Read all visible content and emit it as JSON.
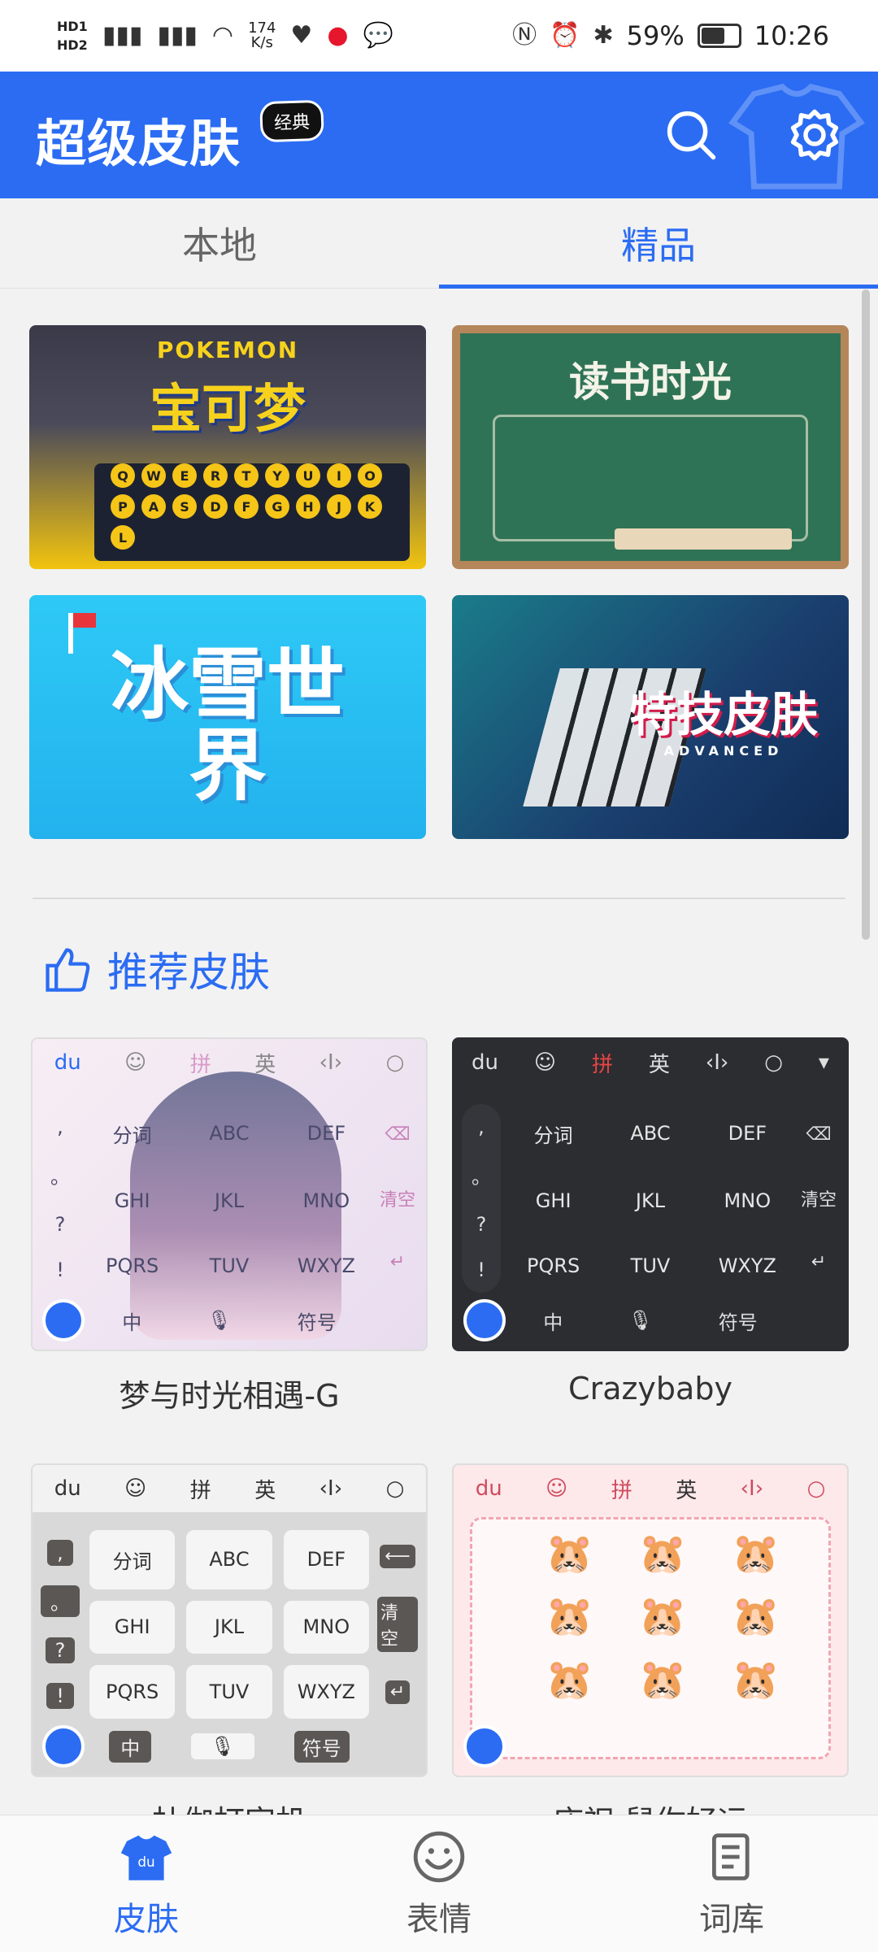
{
  "status_bar": {
    "hd1": "HD1",
    "hd2": "HD2",
    "net_speed": "174\nK/s",
    "battery_percent": "59%",
    "time": "10:26"
  },
  "header": {
    "title": "超级皮肤",
    "badge": "经典",
    "accent_color": "#2b6cf3"
  },
  "tabs": [
    {
      "label": "本地",
      "active": false
    },
    {
      "label": "精品",
      "active": true
    }
  ],
  "banners": [
    {
      "title": "宝可梦",
      "brand": "POKEMON"
    },
    {
      "title": "读书时光"
    },
    {
      "title": "冰雪世界"
    },
    {
      "title": "特技皮肤",
      "subtitle": "ADVANCED"
    }
  ],
  "section": {
    "title": "推荐皮肤"
  },
  "keyboard_keys": {
    "pinyin": "拼",
    "english": "英",
    "fenci": "分词",
    "abc": "ABC",
    "def": "DEF",
    "ghi": "GHI",
    "jkl": "JKL",
    "mno": "MNO",
    "pqrs": "PQRS",
    "tuv": "TUV",
    "wxyz": "WXYZ",
    "clear": "清空",
    "zhong": "中",
    "symbols": "符号"
  },
  "skins": [
    {
      "name": "梦与时光相遇-G"
    },
    {
      "name": "Crazybaby"
    },
    {
      "name": "杜伽打字机"
    },
    {
      "name": "庆祝·鼠你好运"
    }
  ],
  "bottom_nav": [
    {
      "label": "皮肤",
      "active": true
    },
    {
      "label": "表情",
      "active": false
    },
    {
      "label": "词库",
      "active": false
    }
  ]
}
